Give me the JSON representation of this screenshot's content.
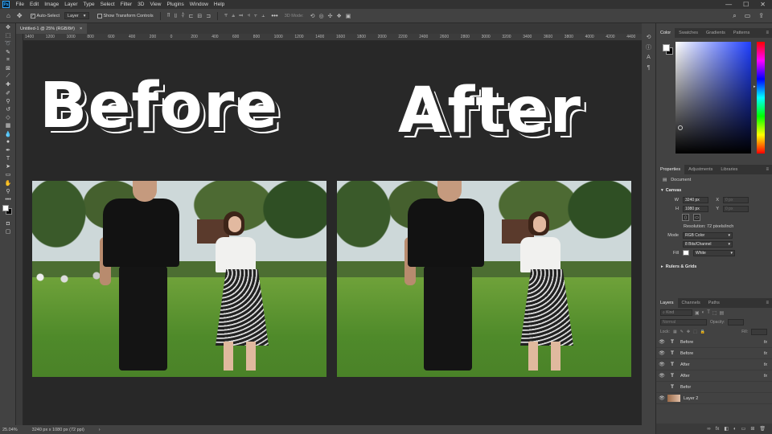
{
  "menubar": {
    "logo": "Ps",
    "items": [
      "File",
      "Edit",
      "Image",
      "Layer",
      "Type",
      "Select",
      "Filter",
      "3D",
      "View",
      "Plugins",
      "Window",
      "Help"
    ],
    "controls": [
      "—",
      "☐",
      "✕"
    ]
  },
  "options": {
    "auto_select_label": "Auto-Select",
    "auto_select_target": "Layer",
    "transform_controls_label": "Show Transform Controls",
    "mode_3d_label": "3D Mode:"
  },
  "document": {
    "tab_title": "Untitled-1 @ 25% (RGB/8#)",
    "tab_close": "×",
    "ruler_ticks": [
      "1400",
      "1200",
      "1000",
      "800",
      "600",
      "400",
      "200",
      "0",
      "200",
      "400",
      "600",
      "800",
      "1000",
      "1200",
      "1400",
      "1600",
      "1800",
      "2000",
      "2200",
      "2400",
      "2600",
      "2800",
      "3000",
      "3200",
      "3400",
      "3600",
      "3800",
      "4000",
      "4200",
      "4400"
    ]
  },
  "canvas": {
    "title_before": "Before",
    "title_after": "After"
  },
  "color_panel": {
    "tabs": [
      "Color",
      "Swatches",
      "Gradients",
      "Patterns"
    ],
    "active_tab": "Color"
  },
  "properties_panel": {
    "tabs": [
      "Properties",
      "Adjustments",
      "Libraries"
    ],
    "doc_label": "Document",
    "canvas_section": "Canvas",
    "w_label": "W",
    "w_value": "3240 px",
    "h_label": "H",
    "h_value": "1080 px",
    "x_label": "X",
    "x_value": "0 px",
    "y_label": "Y",
    "y_value": "0 px",
    "resolution": "Resolution: 72 pixels/inch",
    "mode_label": "Mode",
    "mode_value": "RGB Color",
    "bits_value": "8 Bits/Channel",
    "fill_label": "Fill",
    "fill_value": "White",
    "rulers_section": "Rulers & Grids"
  },
  "layers_panel": {
    "tabs": [
      "Layers",
      "Channels",
      "Paths"
    ],
    "kind_placeholder": "Kind",
    "blend_mode": "Normal",
    "opacity_label": "Opacity:",
    "fill_label": "Fill:",
    "lock_label": "Lock:",
    "layers": [
      {
        "name": "Before",
        "type": "T",
        "visible": true,
        "fx": "fx"
      },
      {
        "name": "Before",
        "type": "T",
        "visible": true,
        "fx": "fx"
      },
      {
        "name": "After",
        "type": "T",
        "visible": true,
        "fx": "fx"
      },
      {
        "name": "After",
        "type": "T",
        "visible": true,
        "fx": "fx"
      },
      {
        "name": "Befor",
        "type": "T",
        "visible": false,
        "fx": ""
      },
      {
        "name": "Layer 2",
        "type": "image",
        "visible": true,
        "fx": ""
      }
    ],
    "footer_icons": [
      "∞",
      "fx",
      "◧",
      "◐",
      "▭",
      "⊞",
      "🗑"
    ]
  },
  "status": {
    "zoom": "25.04%",
    "doc_info": "3240 px x 1080 px (72 ppi)",
    "arrow": "›"
  }
}
